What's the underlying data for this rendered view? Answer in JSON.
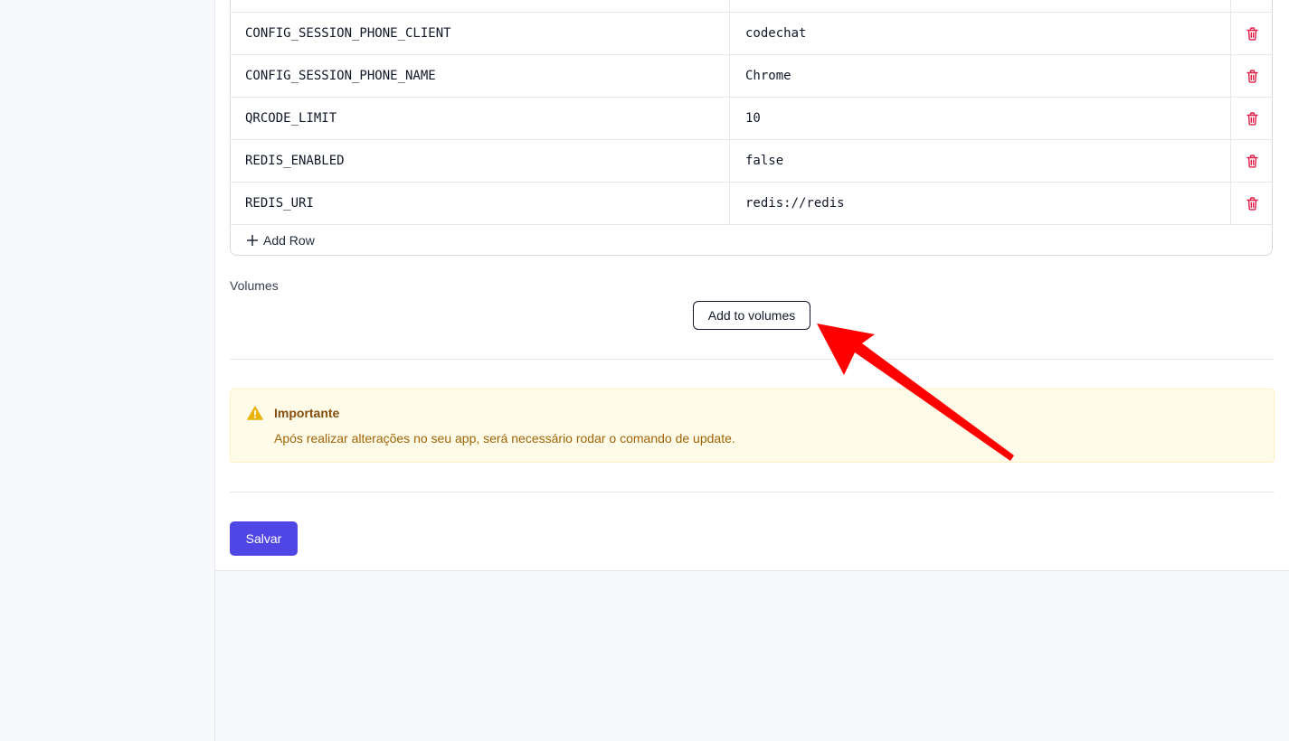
{
  "env_table": {
    "rows": [
      {
        "key": "CONFIG_SESSION_PHONE_CLIENT",
        "value": "codechat"
      },
      {
        "key": "CONFIG_SESSION_PHONE_NAME",
        "value": "Chrome"
      },
      {
        "key": "QRCODE_LIMIT",
        "value": "10"
      },
      {
        "key": "REDIS_ENABLED",
        "value": "false"
      },
      {
        "key": "REDIS_URI",
        "value": "redis://redis"
      }
    ],
    "add_row_label": "Add Row",
    "delete_icon": "trash-icon",
    "delete_color": "#e11d48"
  },
  "volumes": {
    "label": "Volumes",
    "add_button_label": "Add to volumes"
  },
  "alert": {
    "title": "Importante",
    "message": "Após realizar alterações no seu app, será necessário rodar o comando de update.",
    "icon": "warning-icon",
    "icon_color": "#eab308"
  },
  "save_button_label": "Salvar",
  "colors": {
    "primary": "#4f46e5",
    "annotation_arrow": "#ff0000"
  }
}
